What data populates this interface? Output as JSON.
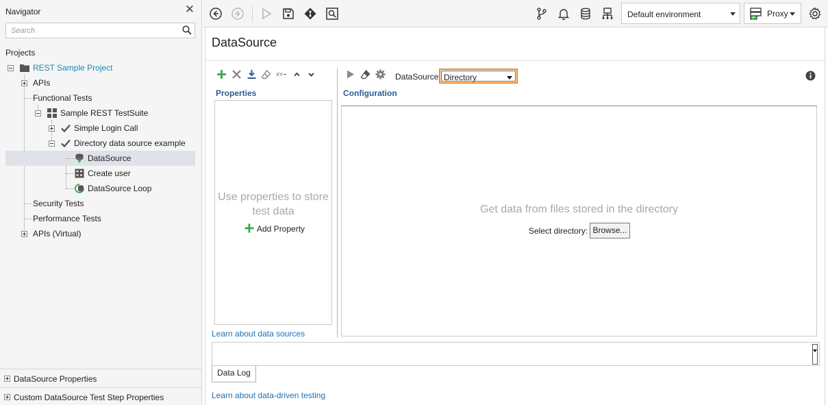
{
  "navigator": {
    "title": "Navigator",
    "search_placeholder": "Search",
    "projects_label": "Projects",
    "tree": {
      "project": "REST Sample Project",
      "apis": "APIs",
      "functional_tests": "Functional Tests",
      "suite": "Sample REST TestSuite",
      "case_login": "Simple Login Call",
      "case_directory": "Directory data source example",
      "step_datasource": "DataSource",
      "step_create_user": "Create user",
      "step_loop": "DataSource Loop",
      "security_tests": "Security Tests",
      "performance_tests": "Performance Tests",
      "apis_virtual": "APIs (Virtual)"
    },
    "bottom_panels": [
      "DataSource Properties",
      "Custom DataSource Test Step Properties"
    ]
  },
  "toolbar": {
    "environment": "Default environment",
    "proxy_label": "Proxy"
  },
  "editor": {
    "title": "DataSource",
    "properties_heading": "Properties",
    "properties_hint": "Use properties to store test data",
    "add_property": "Add Property",
    "learn_data_sources": "Learn about data sources",
    "datasource_label": "DataSource:",
    "datasource_value": "Directory",
    "configuration_heading": "Configuration",
    "config_hint": "Get data from files stored in the directory",
    "select_directory_label": "Select directory:",
    "browse_label": "Browse...",
    "data_log_tab": "Data Log",
    "learn_data_driven": "Learn about data-driven testing"
  },
  "colors": {
    "accent_orange": "#f08a1c",
    "link_blue": "#1f6fb2",
    "heading_blue": "#2a5d97",
    "project_teal": "#1a8bb0",
    "add_green": "#3aa84a"
  }
}
